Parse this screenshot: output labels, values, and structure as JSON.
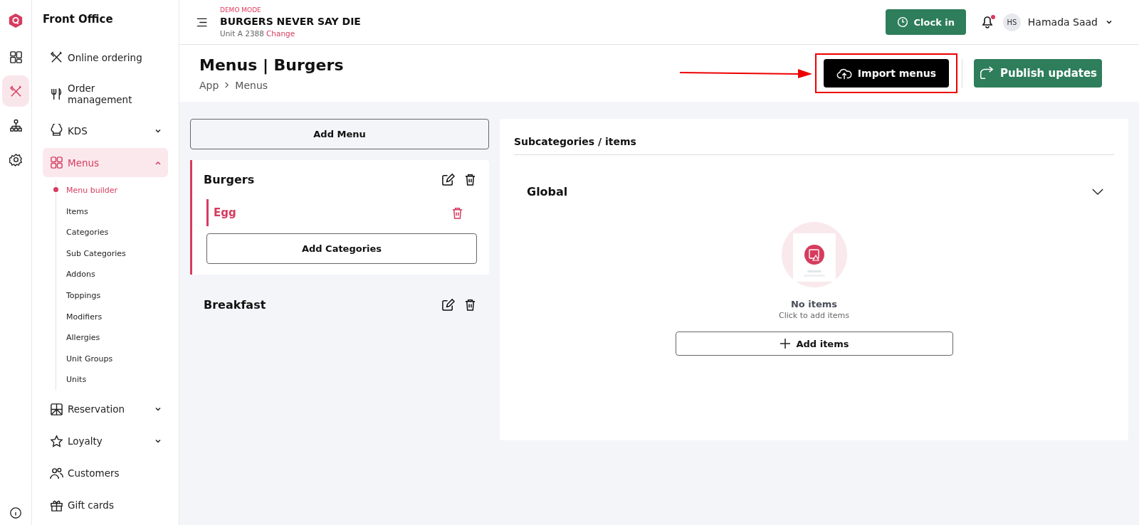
{
  "rail": [
    {
      "selected": false
    },
    {
      "selected": true
    },
    {
      "selected": false
    },
    {
      "selected": false
    }
  ],
  "sidebar": {
    "title": "Front Office",
    "items": [
      {
        "label": "Online ordering",
        "kind": "link",
        "selected": false
      },
      {
        "label": "Order management",
        "kind": "link",
        "selected": false
      },
      {
        "label": "KDS",
        "kind": "group",
        "expanded": false,
        "selected": false
      },
      {
        "label": "Menus",
        "kind": "group",
        "expanded": true,
        "selected": true,
        "children": [
          {
            "label": "Menu builder",
            "selected": true
          },
          {
            "label": "Items",
            "selected": false
          },
          {
            "label": "Categories",
            "selected": false
          },
          {
            "label": "Sub Categories",
            "selected": false
          },
          {
            "label": "Addons",
            "selected": false
          },
          {
            "label": "Toppings",
            "selected": false
          },
          {
            "label": "Modifiers",
            "selected": false
          },
          {
            "label": "Allergies",
            "selected": false
          },
          {
            "label": "Unit Groups",
            "selected": false
          },
          {
            "label": "Units",
            "selected": false
          }
        ]
      },
      {
        "label": "Reservation",
        "kind": "group",
        "expanded": false,
        "selected": false
      },
      {
        "label": "Loyalty",
        "kind": "group",
        "expanded": false,
        "selected": false
      },
      {
        "label": "Customers",
        "kind": "link",
        "selected": false
      },
      {
        "label": "Gift cards",
        "kind": "link",
        "selected": false
      }
    ]
  },
  "header": {
    "mode": "DEMO MODE",
    "business": "BURGERS NEVER SAY DIE",
    "unit": "Unit A 2388",
    "change_link": "Change",
    "clock_in": "Clock in",
    "notifications_unread": true,
    "user_initials": "HS",
    "user_name": "Hamada Saad"
  },
  "page": {
    "title": "Menus | Burgers",
    "breadcrumbs": [
      "App",
      "Menus"
    ],
    "import_button": "Import menus",
    "import_highlighted": true,
    "publish_button": "Publish updates"
  },
  "menus": {
    "add_button": "Add Menu",
    "items": [
      {
        "name": "Burgers",
        "selected": true,
        "expanded": true,
        "categories": [
          {
            "name": "Egg",
            "selected": true
          }
        ],
        "add_categories": "Add Categories"
      },
      {
        "name": "Breakfast",
        "selected": false,
        "expanded": false
      }
    ]
  },
  "panel": {
    "heading": "Subcategories / items",
    "group": {
      "name": "Global",
      "expanded": false
    },
    "empty_title": "No items",
    "empty_hint": "Click to add items",
    "add_items": "Add items"
  }
}
